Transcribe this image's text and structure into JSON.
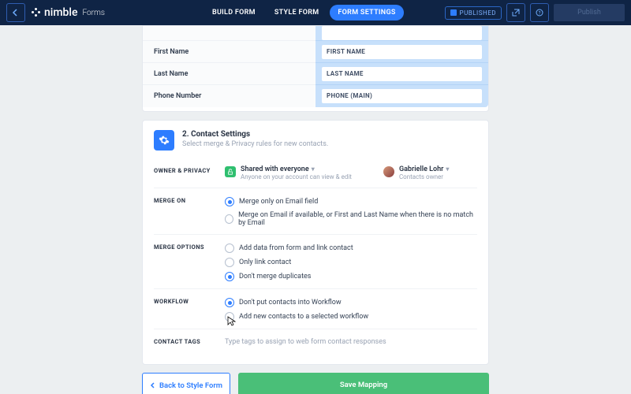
{
  "topbar": {
    "brand": "nimble",
    "brand_sub": "Forms",
    "tabs": {
      "build": "BUILD FORM",
      "style": "STYLE FORM",
      "settings": "FORM SETTINGS"
    },
    "published": "PUBLISHED",
    "publish_btn": "Publish"
  },
  "mapping": {
    "row0_label": "",
    "row0_field": "",
    "row1_label": "First Name",
    "row1_field": "FIRST NAME",
    "row2_label": "Last Name",
    "row2_field": "LAST NAME",
    "row3_label": "Phone Number",
    "row3_field": "PHONE (MAIN)"
  },
  "card": {
    "title": "2. Contact Settings",
    "subtitle": "Select merge & Privacy rules for new contacts."
  },
  "owner": {
    "section_label": "OWNER & PRIVACY",
    "shared_title": "Shared with everyone",
    "shared_sub": "Anyone on your account can view & edit",
    "user_name": "Gabrielle Lohr",
    "user_sub": "Contacts owner"
  },
  "merge_on": {
    "label": "MERGE ON",
    "opt1": "Merge only on Email field",
    "opt2": "Merge on Email if available, or First and Last Name when there is no match by Email"
  },
  "merge_opts": {
    "label": "MERGE OPTIONS",
    "opt1": "Add data from form and link contact",
    "opt2": "Only link contact",
    "opt3": "Don't merge duplicates"
  },
  "workflow": {
    "label": "WORKFLOW",
    "opt1": "Don't put contacts into Workflow",
    "opt2": "Add new contacts to a selected workflow"
  },
  "tags": {
    "label": "CONTACT TAGS",
    "placeholder": "Type tags to assign to web form contact responses"
  },
  "footer": {
    "back": "Back to Style Form",
    "save": "Save Mapping"
  }
}
